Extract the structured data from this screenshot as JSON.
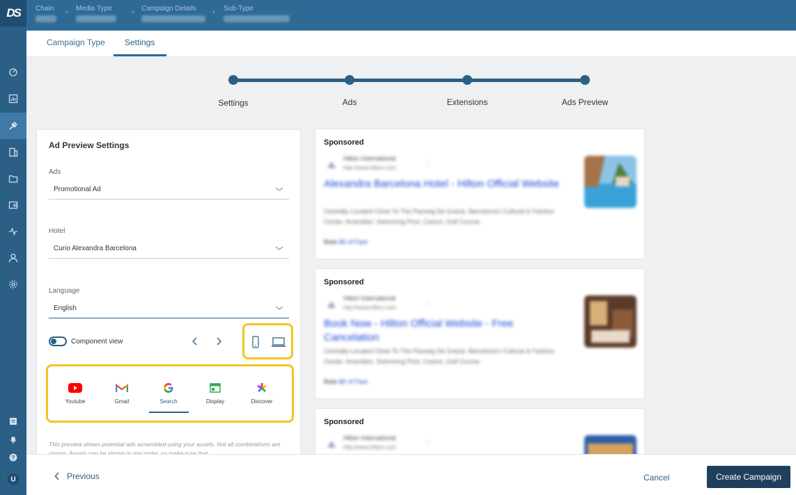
{
  "app": {
    "logo_text": "DS"
  },
  "breadcrumb": [
    {
      "label": "Chain",
      "value": ""
    },
    {
      "label": "Media Type",
      "value": ""
    },
    {
      "label": "Campaign Details",
      "value": ""
    },
    {
      "label": "Sub-Type",
      "value": ""
    }
  ],
  "tabs": [
    {
      "label": "Campaign Type",
      "active": false
    },
    {
      "label": "Settings",
      "active": true
    }
  ],
  "stepper": {
    "steps": [
      "Settings",
      "Ads",
      "Extensions",
      "Ads Preview"
    ],
    "current": 0
  },
  "settings_panel": {
    "title": "Ad Preview Settings",
    "ads": {
      "label": "Ads",
      "value": "Promotional Ad"
    },
    "hotel": {
      "label": "Hotel",
      "value": "Curio Alexandra Barcelona"
    },
    "language": {
      "label": "Language",
      "value": "English"
    },
    "component_view": {
      "label": "Component view",
      "enabled": false
    },
    "channels": [
      {
        "name": "Youtube",
        "icon": "youtube-icon"
      },
      {
        "name": "Gmail",
        "icon": "gmail-icon"
      },
      {
        "name": "Search",
        "icon": "google-icon",
        "active": true
      },
      {
        "name": "Display",
        "icon": "display-icon"
      },
      {
        "name": "Discover",
        "icon": "discover-icon"
      }
    ],
    "note": "This preview shows potential ads assembled using your assets. Not all combinations are shown. Assets can be shown in any order, so make sure that"
  },
  "ad_previews": [
    {
      "sponsored": "Sponsored",
      "advertiser": "Hilton International",
      "url": "http://www.hilton.com",
      "headline": "Alexandra Barcelona Hotel - Hilton Official Website",
      "description": "Centrally Located Close To The Passeig De Gracia. Barcelona's Cultural & Fashion Center. Amenities: Swimming Pool, Casino, Golf Course.",
      "rate_label": "Rate",
      "rate_value": "$0 of Fare",
      "image": "pool-image"
    },
    {
      "sponsored": "Sponsored",
      "advertiser": "Hilton International",
      "url": "http://www.hilton.com",
      "headline": "Book Now - Hilton Official Website - Free Cancelation",
      "description": "Centrally Located Close To The Passeig De Gracia. Barcelona's Cultural & Fashion Center. Amenities: Swimming Pool, Casino, Golf Course.",
      "rate_label": "Rate",
      "rate_value": "$0 of Fare",
      "image": "room-image"
    },
    {
      "sponsored": "Sponsored",
      "advertiser": "Hilton International",
      "url": "http://www.hilton.com",
      "image": "building-image"
    }
  ],
  "footer": {
    "previous": "Previous",
    "cancel": "Cancel",
    "create": "Create Campaign"
  },
  "colors": {
    "primary": "#2b5f86",
    "header": "#2e6a96",
    "highlight": "#f3c41f",
    "link": "#1a47d6",
    "cta": "#1f3f5e"
  }
}
